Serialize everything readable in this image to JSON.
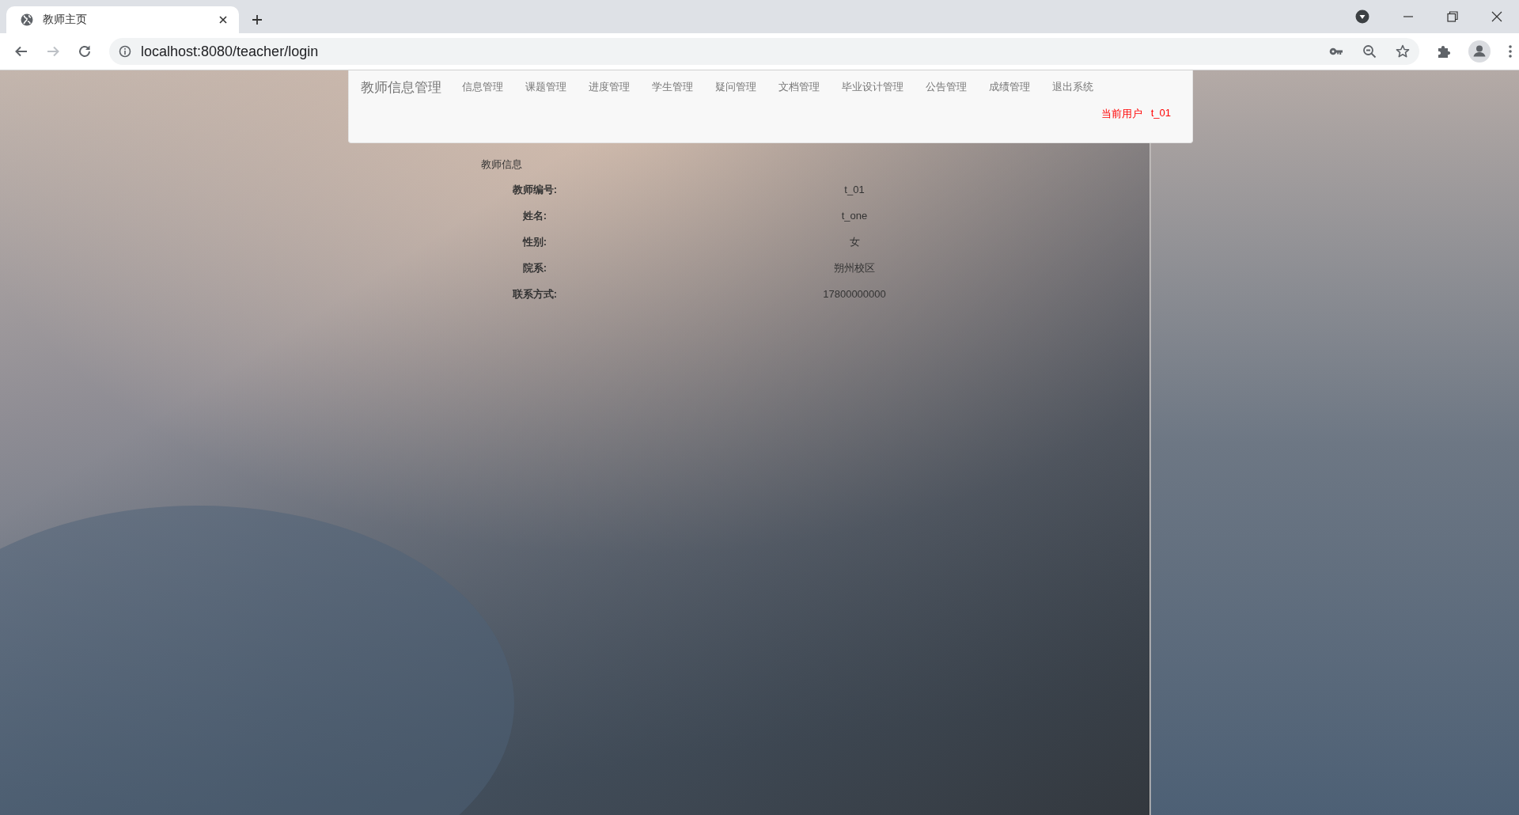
{
  "browser": {
    "tab": {
      "title": "教师主页",
      "selected": true
    },
    "url": "localhost:8080/teacher/login",
    "forward_disabled": true
  },
  "nav": {
    "brand": "教师信息管理",
    "items": [
      {
        "label": "信息管理"
      },
      {
        "label": "课题管理"
      },
      {
        "label": "进度管理"
      },
      {
        "label": "学生管理"
      },
      {
        "label": "疑问管理"
      },
      {
        "label": "文档管理"
      },
      {
        "label": "毕业设计管理"
      },
      {
        "label": "公告管理"
      },
      {
        "label": "成绩管理"
      },
      {
        "label": "退出系统"
      }
    ],
    "user_label": "当前用户",
    "user_name": "t_01"
  },
  "info": {
    "title": "教师信息",
    "rows": [
      {
        "label": "教师编号:",
        "value": "t_01"
      },
      {
        "label": "姓名:",
        "value": "t_one"
      },
      {
        "label": "性别:",
        "value": "女"
      },
      {
        "label": "院系:",
        "value": "朔州校区"
      },
      {
        "label": "联系方式:",
        "value": "17800000000"
      }
    ]
  }
}
